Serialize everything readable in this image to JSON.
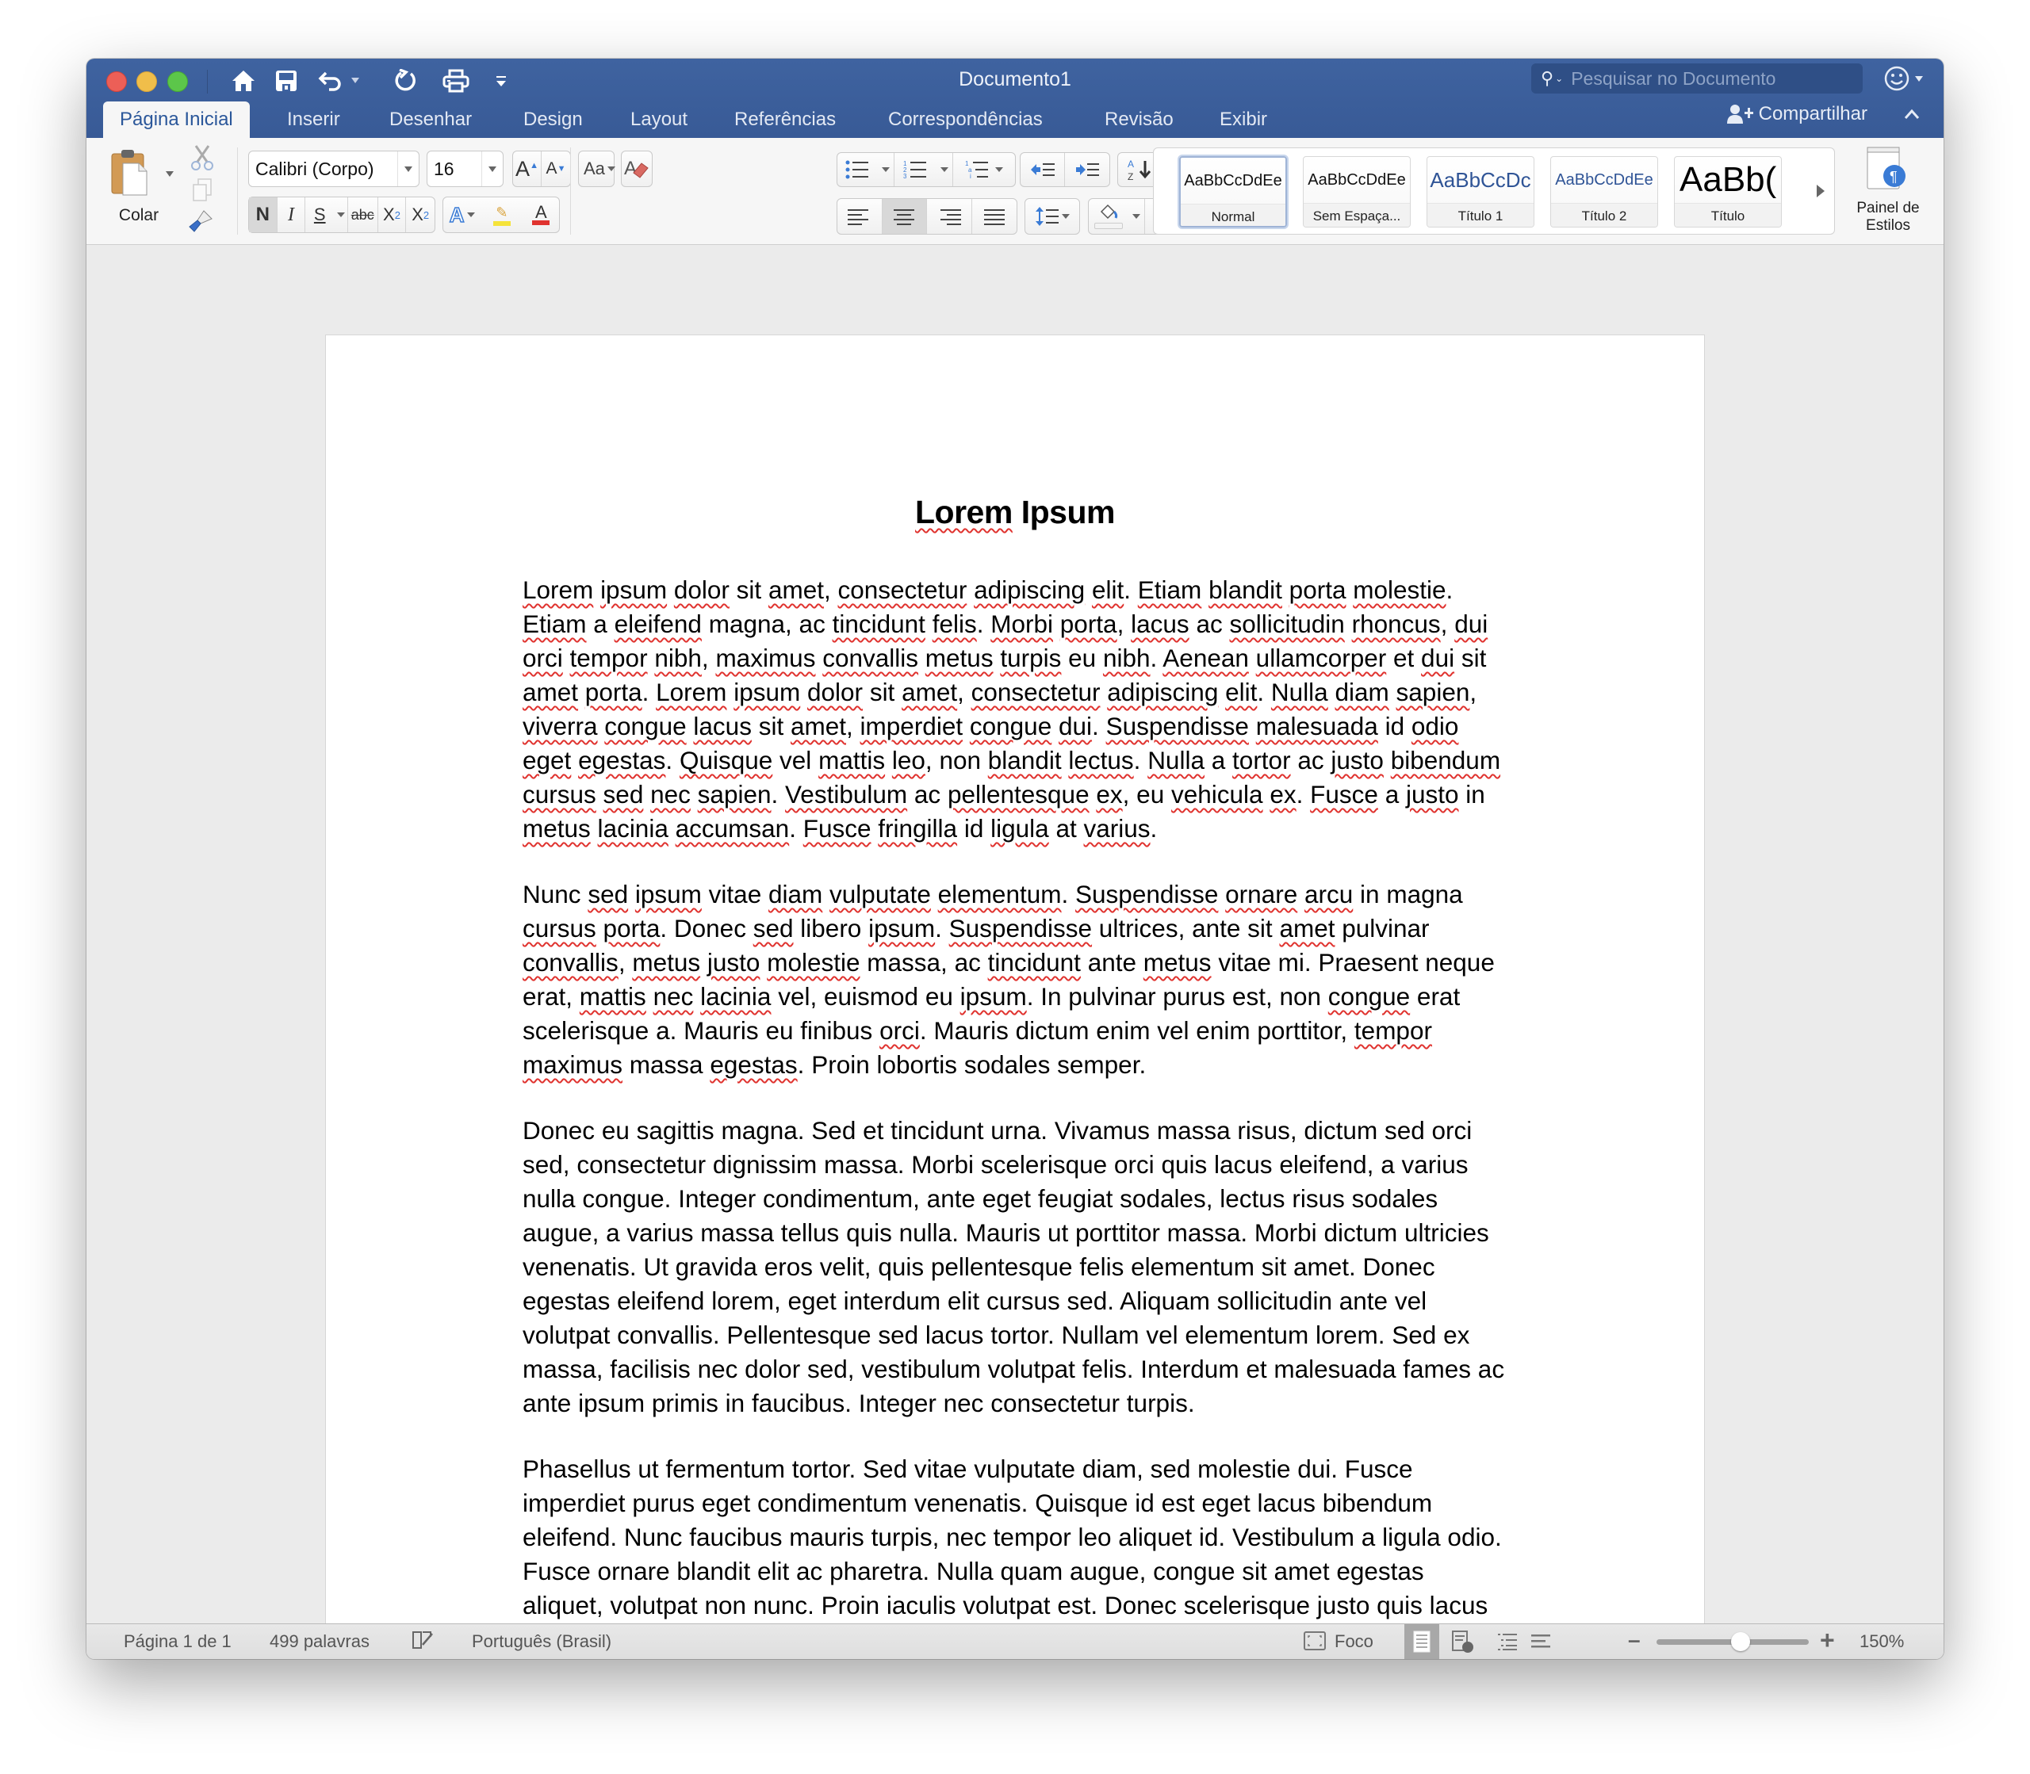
{
  "window": {
    "title": "Documento1",
    "search_placeholder": "Pesquisar no Documento",
    "accent_color": "#2b579a",
    "titlebar_color": "#3f63a0"
  },
  "quick_access": [
    {
      "name": "home-icon"
    },
    {
      "name": "save-icon"
    },
    {
      "name": "undo-icon"
    },
    {
      "name": "redo-icon"
    },
    {
      "name": "print-icon"
    },
    {
      "name": "customize-toolbar-icon"
    }
  ],
  "tabs": [
    {
      "label": "Página Inicial",
      "active": true
    },
    {
      "label": "Inserir"
    },
    {
      "label": "Desenhar"
    },
    {
      "label": "Design"
    },
    {
      "label": "Layout"
    },
    {
      "label": "Referências"
    },
    {
      "label": "Correspondências"
    },
    {
      "label": "Revisão"
    },
    {
      "label": "Exibir"
    }
  ],
  "share_label": "Compartilhar",
  "ribbon": {
    "paste_label": "Colar",
    "font_name": "Calibri (Corpo)",
    "font_size": "16",
    "bold_label": "N",
    "italic_label": "I",
    "underline_label": "S",
    "strike_label": "abc",
    "subscript_label": "X",
    "subscript_sub": "2",
    "superscript_label": "X",
    "superscript_sup": "2",
    "grow_font_label": "A",
    "shrink_font_label": "A",
    "change_case_label": "Aa",
    "font_color_label": "A",
    "font_color": "#e0332f",
    "highlight_color": "#f5e33a",
    "sort_label": "A Z",
    "pilcrow": "¶",
    "styles": [
      {
        "sample": "AaBbCcDdEe",
        "name": "Normal",
        "selected": true
      },
      {
        "sample": "AaBbCcDdEe",
        "name": "Sem Espaça..."
      },
      {
        "sample": "AaBbCcDc",
        "name": "Título 1"
      },
      {
        "sample": "AaBbCcDdEe",
        "name": "Título 2"
      },
      {
        "sample": "AaBb(",
        "name": "Título"
      }
    ],
    "styles_pane_label_1": "Painel de",
    "styles_pane_label_2": "Estilos"
  },
  "document": {
    "heading": "Lorem Ipsum",
    "paragraphs": [
      "Lorem ipsum dolor sit amet, consectetur adipiscing elit. Etiam blandit porta molestie. Etiam a eleifend magna, ac tincidunt felis. Morbi porta, lacus ac sollicitudin rhoncus, dui orci tempor nibh, maximus convallis metus turpis eu nibh. Aenean ullamcorper et dui sit amet porta. Lorem ipsum dolor sit amet, consectetur adipiscing elit. Nulla diam sapien, viverra congue lacus sit amet, imperdiet congue dui. Suspendisse malesuada id odio eget egestas. Quisque vel mattis leo, non blandit lectus. Nulla a tortor ac justo bibendum cursus sed nec sapien. Vestibulum ac pellentesque ex, eu vehicula ex. Fusce a justo in metus lacinia accumsan. Fusce fringilla id ligula at varius.",
      "Nunc sed ipsum vitae diam vulputate elementum. Suspendisse ornare arcu in magna cursus porta. Donec sed libero ipsum. Suspendisse ultrices, ante sit amet pulvinar convallis, metus justo molestie massa, ac tincidunt ante metus vitae mi. Praesent neque erat, mattis nec lacinia vel, euismod eu ipsum. In pulvinar purus est, non congue erat scelerisque a. Mauris eu finibus orci. Mauris dictum enim vel enim porttitor, tempor maximus massa egestas. Proin lobortis sodales semper.",
      "Donec eu sagittis magna. Sed et tincidunt urna. Vivamus massa risus, dictum sed orci sed, consectetur dignissim massa. Morbi scelerisque orci quis lacus eleifend, a varius nulla congue. Integer condimentum, ante eget feugiat sodales, lectus risus sodales augue, a varius massa tellus quis nulla. Mauris ut porttitor massa. Morbi dictum ultricies venenatis. Ut gravida eros velit, quis pellentesque felis elementum sit amet. Donec egestas eleifend lorem, eget interdum elit cursus sed. Aliquam sollicitudin ante vel volutpat convallis. Pellentesque sed lacus tortor. Nullam vel elementum lorem. Sed ex massa, facilisis nec dolor sed, vestibulum volutpat felis. Interdum et malesuada fames ac ante ipsum primis in faucibus. Integer nec consectetur turpis.",
      "Phasellus ut fermentum tortor. Sed vitae vulputate diam, sed molestie dui. Fusce imperdiet purus eget condimentum venenatis. Quisque id est eget lacus bibendum eleifend. Nunc faucibus mauris turpis, nec tempor leo aliquet id. Vestibulum a ligula odio. Fusce ornare blandit elit ac pharetra. Nulla quam augue, congue sit amet egestas aliquet, volutpat non nunc. Proin iaculis volutpat est. Donec scelerisque justo quis lacus congue sollicitudin. Ut non tortor id est porttitor consectetur quis id odio. Nullam diam mauris, hendrerit vel mauris id, ultrices volutpat ipsum. Suspendisse ac elit."
    ],
    "misspelled_words": [
      "Lorem",
      "Ipsum",
      "ipsum",
      "dolor",
      "amet",
      "consectetur",
      "adipiscing",
      "elit",
      "Etiam",
      "blandit",
      "molestie",
      "eleifend",
      "tincidunt",
      "felis",
      "Morbi",
      "lacus",
      "sollicitudin",
      "rhoncus",
      "dui",
      "orci",
      "tempor",
      "nibh",
      "maximus",
      "convallis",
      "metus",
      "turpis",
      "Aenean",
      "ullamcorper",
      "Nulla",
      "diam",
      "sapien",
      "viverra",
      "congue",
      "imperdiet",
      "Suspendisse",
      "malesuada",
      "odio",
      "eget",
      "egestas",
      "Quisque",
      "mattis",
      "leo",
      "lectus",
      "tortor",
      "justo",
      "bibendum",
      "cursus",
      "nec",
      "Vestibulum",
      "pellentesque",
      "ex",
      "vehicula",
      "Fusce",
      "lacinia",
      "accumsan",
      "fringilla",
      "ligula",
      "varius",
      "sed",
      "vulputate",
      "elementum",
      "ornare",
      "arcu",
      "porta"
    ],
    "spellcheck_paragraphs": 2
  },
  "status": {
    "page": "Página 1 de 1",
    "words": "499 palavras",
    "language": "Português (Brasil)",
    "focus_label": "Foco",
    "zoom_label": "150%",
    "zoom_slider_fraction": 0.55
  }
}
